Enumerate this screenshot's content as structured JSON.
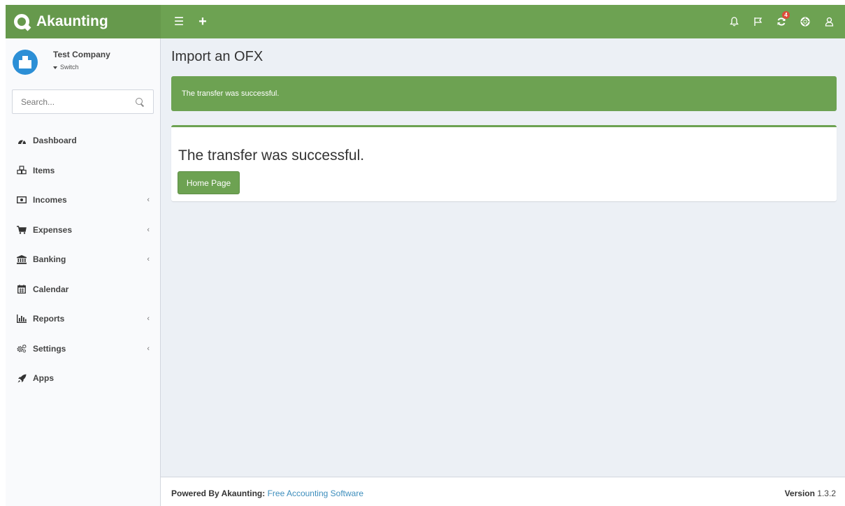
{
  "header": {
    "brand": "Akaunting",
    "notifications_badge": "4"
  },
  "sidebar": {
    "company_name": "Test Company",
    "switch_label": "Switch",
    "search_placeholder": "Search...",
    "items": [
      {
        "label": "Dashboard",
        "icon": "dashboard-icon",
        "has_children": false
      },
      {
        "label": "Items",
        "icon": "items-icon",
        "has_children": false
      },
      {
        "label": "Incomes",
        "icon": "money-icon",
        "has_children": true
      },
      {
        "label": "Expenses",
        "icon": "cart-icon",
        "has_children": true
      },
      {
        "label": "Banking",
        "icon": "bank-icon",
        "has_children": true
      },
      {
        "label": "Calendar",
        "icon": "calendar-icon",
        "has_children": false
      },
      {
        "label": "Reports",
        "icon": "bar-chart-icon",
        "has_children": true
      },
      {
        "label": "Settings",
        "icon": "gears-icon",
        "has_children": true
      },
      {
        "label": "Apps",
        "icon": "rocket-icon",
        "has_children": false
      }
    ]
  },
  "main": {
    "page_title": "Import an OFX",
    "alert_message": "The transfer was successful.",
    "box_title": "The transfer was successful.",
    "home_button": "Home Page"
  },
  "footer": {
    "powered_by": "Powered By Akaunting",
    "separator": ":",
    "link_text": "Free Accounting Software",
    "version_label": "Version",
    "version_number": "1.3.2"
  },
  "colors": {
    "brand_green": "#6da252",
    "avatar_blue": "#2c8fd6",
    "badge_red": "#dd4b39",
    "link_blue": "#3c8dbc"
  }
}
